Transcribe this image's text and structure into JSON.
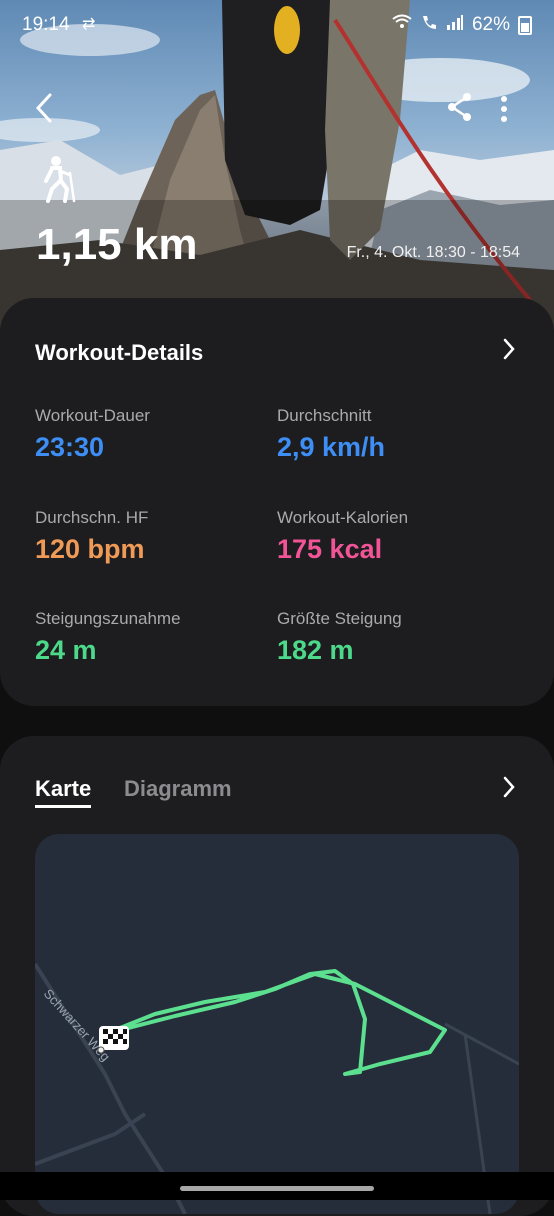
{
  "status_bar": {
    "time": "19:14",
    "battery": "62%"
  },
  "hero": {
    "distance": "1,15 km",
    "datetime": "Fr., 4. Okt. 18:30 - 18:54"
  },
  "workout_details": {
    "title": "Workout-Details",
    "stats": [
      {
        "label": "Workout-Dauer",
        "value": "23:30",
        "color": "#3d8ef5"
      },
      {
        "label": "Durchschnitt",
        "value": "2,9 km/h",
        "color": "#3d8ef5"
      },
      {
        "label": "Durchschn. HF",
        "value": "120 bpm",
        "color": "#ef9a57"
      },
      {
        "label": "Workout-Kalorien",
        "value": "175 kcal",
        "color": "#f25597"
      },
      {
        "label": "Steigungszunahme",
        "value": "24 m",
        "color": "#4dd98a"
      },
      {
        "label": "Größte Steigung",
        "value": "182 m",
        "color": "#4dd98a"
      }
    ]
  },
  "map_section": {
    "tabs": [
      "Karte",
      "Diagramm"
    ],
    "street_name": "Schwarzer Weg",
    "route_color": "#5ce08f"
  },
  "icons": [
    "back-icon",
    "share-icon",
    "more-icon",
    "hiking-icon",
    "chevron-right-icon",
    "finish-flag-icon"
  ]
}
